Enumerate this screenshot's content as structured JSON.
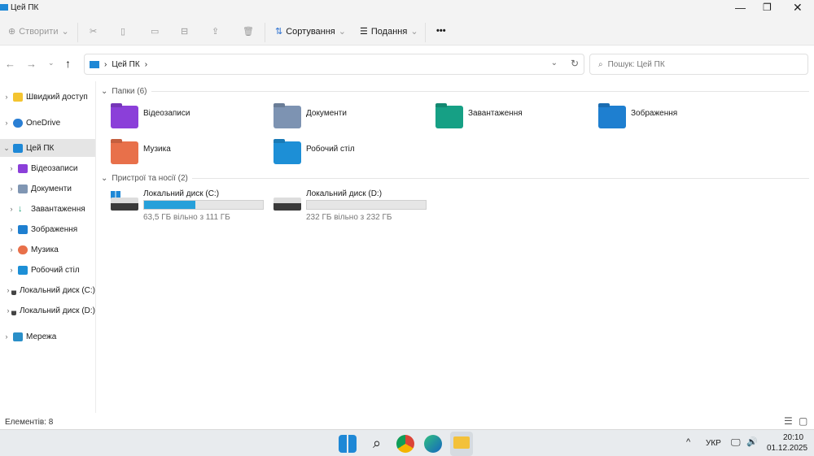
{
  "window": {
    "title": "Цей ПК"
  },
  "toolbar": {
    "create": "Створити",
    "sort": "Сортування",
    "view": "Подання",
    "more": "•••"
  },
  "address": {
    "path": "Цей ПК",
    "search_placeholder": "Пошук: Цей ПК"
  },
  "sidebar": {
    "items": [
      {
        "label": "Швидкий доступ",
        "color": "#f4c430"
      },
      {
        "label": "OneDrive",
        "color": "#2a7fd4"
      },
      {
        "label": "Цей ПК",
        "color": "#1e88d6"
      },
      {
        "label": "Відеозаписи",
        "color": "#8b3fd9"
      },
      {
        "label": "Документи",
        "color": "#8096b3"
      },
      {
        "label": "Завантаження",
        "color": "#1a9e7a"
      },
      {
        "label": "Зображення",
        "color": "#1e7fd0"
      },
      {
        "label": "Музика",
        "color": "#e8704a"
      },
      {
        "label": "Робочий стіл",
        "color": "#1d8fd6"
      },
      {
        "label": "Локальний диск (C:)",
        "color": "#444"
      },
      {
        "label": "Локальний диск (D:)",
        "color": "#444"
      },
      {
        "label": "Мережа",
        "color": "#2a8fc8"
      }
    ]
  },
  "folders": {
    "header": "Папки (6)",
    "items": [
      {
        "name": "Відеозаписи",
        "color": "#8b3fd9"
      },
      {
        "name": "Документи",
        "color": "#7d93b2"
      },
      {
        "name": "Завантаження",
        "color": "#16a085"
      },
      {
        "name": "Зображення",
        "color": "#1e7fd0"
      },
      {
        "name": "Музика",
        "color": "#e8704a"
      },
      {
        "name": "Робочий стіл",
        "color": "#1d8fd6"
      }
    ]
  },
  "drives": {
    "header": "Пристрої та носії (2)",
    "items": [
      {
        "name": "Локальний диск (C:)",
        "free": "63,5 ГБ вільно з 111 ГБ",
        "used_fraction": 0.43
      },
      {
        "name": "Локальний диск (D:)",
        "free": "232 ГБ вільно з 232 ГБ",
        "used_fraction": 0.0
      }
    ]
  },
  "status": {
    "count": "Елементів: 8"
  },
  "taskbar": {
    "lang": "УКР",
    "time": "20:10",
    "date": "01.12.2025"
  }
}
